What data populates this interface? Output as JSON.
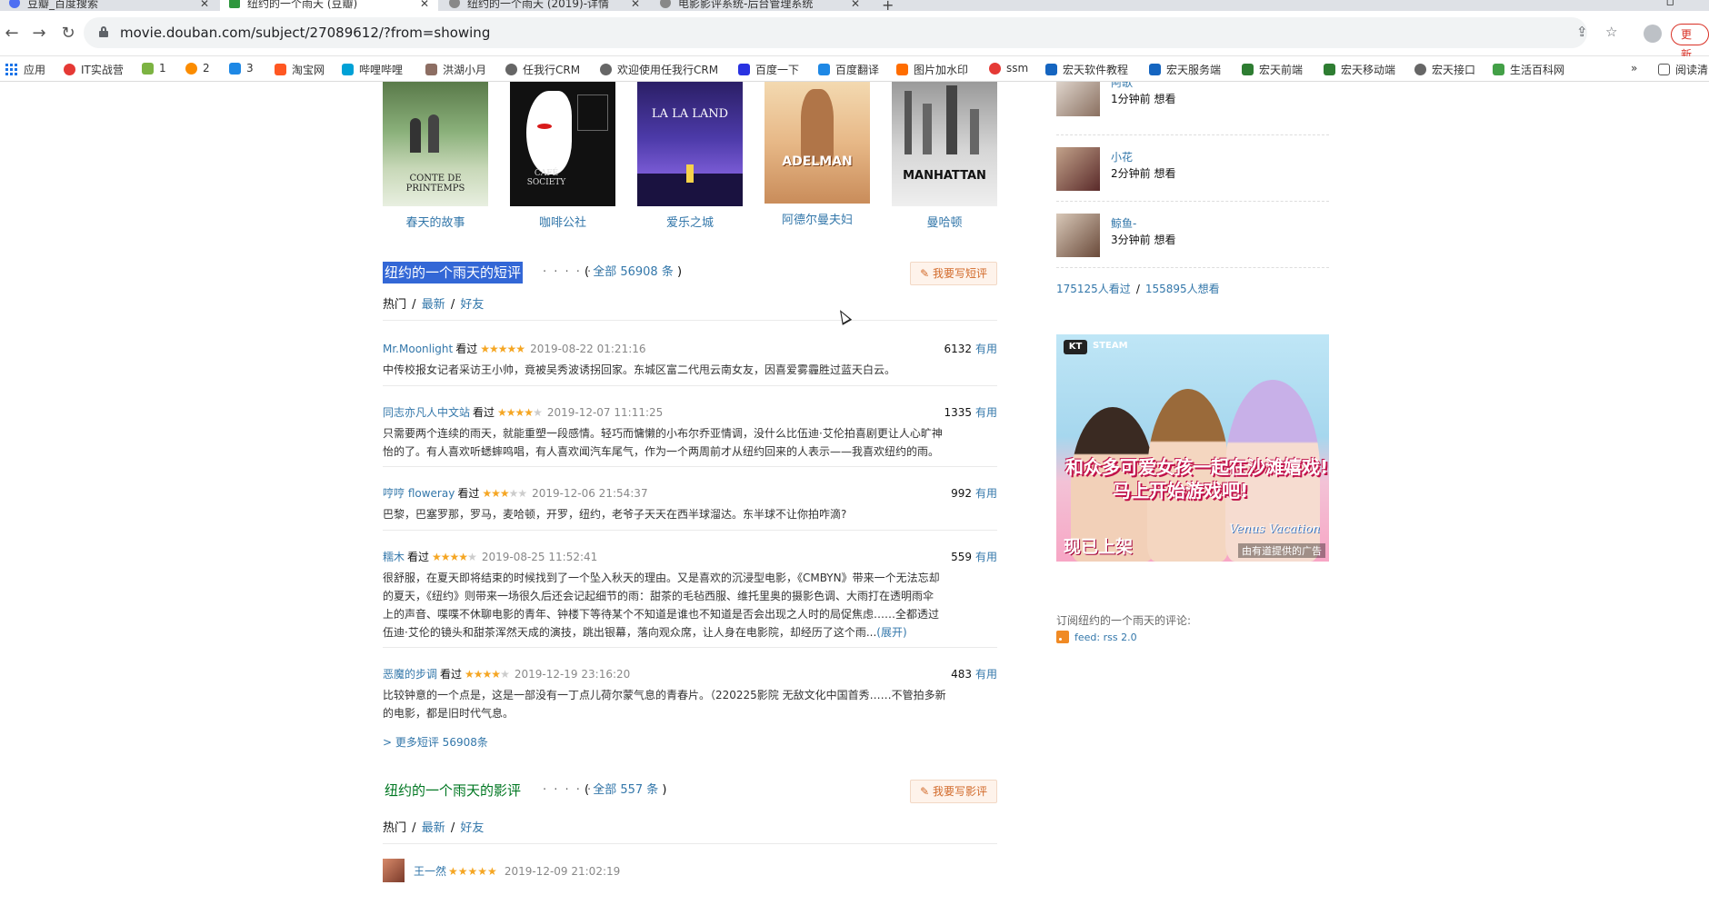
{
  "browser": {
    "tabs": [
      {
        "title": "豆瓣_百度搜索",
        "active": false
      },
      {
        "title": "纽约的一个雨天 (豆瓣)",
        "active": true
      },
      {
        "title": "纽约的一个雨天 (2019)-详情",
        "active": false
      },
      {
        "title": "电影影评系统-后台管理系统",
        "active": false
      }
    ],
    "url": "movie.douban.com/subject/27089612/?from=showing",
    "update_label": "更新",
    "bookmarks": [
      {
        "label": "应用",
        "icon": "apps-icon"
      },
      {
        "label": "IT实战营",
        "icon": "it-icon"
      },
      {
        "label": "1",
        "icon": "cloud-icon"
      },
      {
        "label": "2",
        "icon": "swirl-icon"
      },
      {
        "label": "3",
        "icon": "bird-icon"
      },
      {
        "label": "淘宝网",
        "icon": "taobao-icon"
      },
      {
        "label": "哔哩哔哩",
        "icon": "bilibili-icon"
      },
      {
        "label": "洪湖小月",
        "icon": "leaf-icon"
      },
      {
        "label": "任我行CRM",
        "icon": "globe-icon"
      },
      {
        "label": "欢迎使用任我行CRM",
        "icon": "globe-icon"
      },
      {
        "label": "百度一下",
        "icon": "baidu-paw-icon"
      },
      {
        "label": "百度翻译",
        "icon": "translate-icon"
      },
      {
        "label": "图片加水印",
        "icon": "image-icon"
      },
      {
        "label": "ssm",
        "icon": "g-icon"
      },
      {
        "label": "宏天软件教程",
        "icon": "ht-icon"
      },
      {
        "label": "宏天服务端",
        "icon": "ht-icon"
      },
      {
        "label": "宏天前端",
        "icon": "vue-icon"
      },
      {
        "label": "宏天移动端",
        "icon": "vue-icon"
      },
      {
        "label": "宏天接口",
        "icon": "globe-icon"
      },
      {
        "label": "生活百科网",
        "icon": "book-icon"
      }
    ],
    "more_bookmarks": "»",
    "reading_list": "阅读清"
  },
  "recommendations": [
    {
      "title": "春天的故事",
      "poster_text": "CONTE DE PRINTEMPS"
    },
    {
      "title": "咖啡公社",
      "poster_text": "CAFÉ SOCIETY"
    },
    {
      "title": "爱乐之城",
      "poster_text": "LA LA LAND"
    },
    {
      "title": "阿德尔曼夫妇",
      "poster_text": "ADELMAN"
    },
    {
      "title": "曼哈顿",
      "poster_text": "MANHATTAN"
    }
  ],
  "short_comments": {
    "title": "纽约的一个雨天的短评",
    "dots": "· · · · · ·",
    "count_prefix": "( ",
    "count_link": "全部 56908 条",
    "count_suffix": " )",
    "write_label": "我要写短评",
    "filters": [
      "热门",
      "/",
      "最新",
      "/",
      "好友"
    ],
    "items": [
      {
        "user": "Mr.Moonlight",
        "status": "看过",
        "stars": 5,
        "time": "2019-08-22 01:21:16",
        "votes": "6132",
        "useful": "有用",
        "lines": [
          "中传校报女记者采访王小帅，竟被吴秀波诱拐回家。东城区富二代甩云南女友，因喜爱雾霾胜过蓝天白云。"
        ]
      },
      {
        "user": "同志亦凡人中文站",
        "status": "看过",
        "stars": 4,
        "time": "2019-12-07 11:11:25",
        "votes": "1335",
        "useful": "有用",
        "lines": [
          "只需要两个连续的雨天，就能重塑一段感情。轻巧而慵懒的小布尔乔亚情调，没什么比伍迪·艾伦拍喜剧更让人心旷神",
          "怡的了。有人喜欢听蟋蟀鸣唱，有人喜欢闻汽车尾气，作为一个两周前才从纽约回来的人表示——我喜欢纽约的雨。"
        ]
      },
      {
        "user": "哼哼 floweray",
        "status": "看过",
        "stars": 3,
        "time": "2019-12-06 21:54:37",
        "votes": "992",
        "useful": "有用",
        "lines": [
          "巴黎，巴塞罗那，罗马，麦哈顿，开罗，纽约，老爷子天天在西半球溜达。东半球不让你拍咋滴?"
        ]
      },
      {
        "user": "糯木",
        "status": "看过",
        "stars": 4,
        "time": "2019-08-25 11:52:41",
        "votes": "559",
        "useful": "有用",
        "lines": [
          "很舒服，在夏天即将结束的时候找到了一个坠入秋天的理由。又是喜欢的沉浸型电影，《CMBYN》带来一个无法忘却",
          "的夏天，《纽约》则带来一场很久后还会记起细节的雨：甜茶的毛毡西服、维托里奥的摄影色调、大雨打在透明雨伞",
          "上的声音、喋喋不休聊电影的青年、钟楼下等待某个不知道是谁也不知道是否会出现之人时的局促焦虑……全都透过",
          "伍迪·艾伦的镜头和甜茶浑然天成的演技，跳出银幕，落向观众席，让人身在电影院，却经历了这个雨..."
        ],
        "expand": "(展开)"
      },
      {
        "user": "恶魔的步调",
        "status": "看过",
        "stars": 4,
        "time": "2019-12-19 23:16:20",
        "votes": "483",
        "useful": "有用",
        "lines": [
          "比较钟意的一个点是，这是一部没有一丁点儿荷尔蒙气息的青春片。（220225影院 无敌文化中国首秀……不管拍多新",
          "的电影，都是旧时代气息。"
        ]
      }
    ],
    "more_link": "> 更多短评 56908条"
  },
  "reviews": {
    "title": "纽约的一个雨天的影评",
    "dots": "· · · · · ·",
    "count_prefix": "( ",
    "count_link": "全部 557 条",
    "count_suffix": " )",
    "write_label": "我要写影评",
    "filters": [
      "热门",
      "/",
      "最新",
      "/",
      "好友"
    ],
    "first": {
      "user": "王一然",
      "stars": 5,
      "time": "2019-12-09 21:02:19"
    }
  },
  "sidebar": {
    "wishers": [
      {
        "name": "阿歌",
        "time": "1分钟前 想看"
      },
      {
        "name": "小花",
        "time": "2分钟前 想看"
      },
      {
        "name": "鲸鱼-",
        "time": "3分钟前 想看"
      }
    ],
    "watched": "175125人看过",
    "separator": "/",
    "wanted": "155895人想看",
    "ad": {
      "logo_kt": "KT",
      "logo_steam": "STEAM",
      "line1": "和众多可爱女孩一起在沙滩嬉戏!",
      "line2": "马上开始游戏吧!",
      "now": "现已上架",
      "brand": "Venus Vacation",
      "credit": "由有道提供的广告"
    },
    "subscribe": "订阅纽约的一个雨天的评论:",
    "feed": "feed: rss 2.0"
  },
  "colors": {
    "link": "#3377aa",
    "title_green": "#007722",
    "star": "#f5a623",
    "selection": "#3367d6"
  }
}
